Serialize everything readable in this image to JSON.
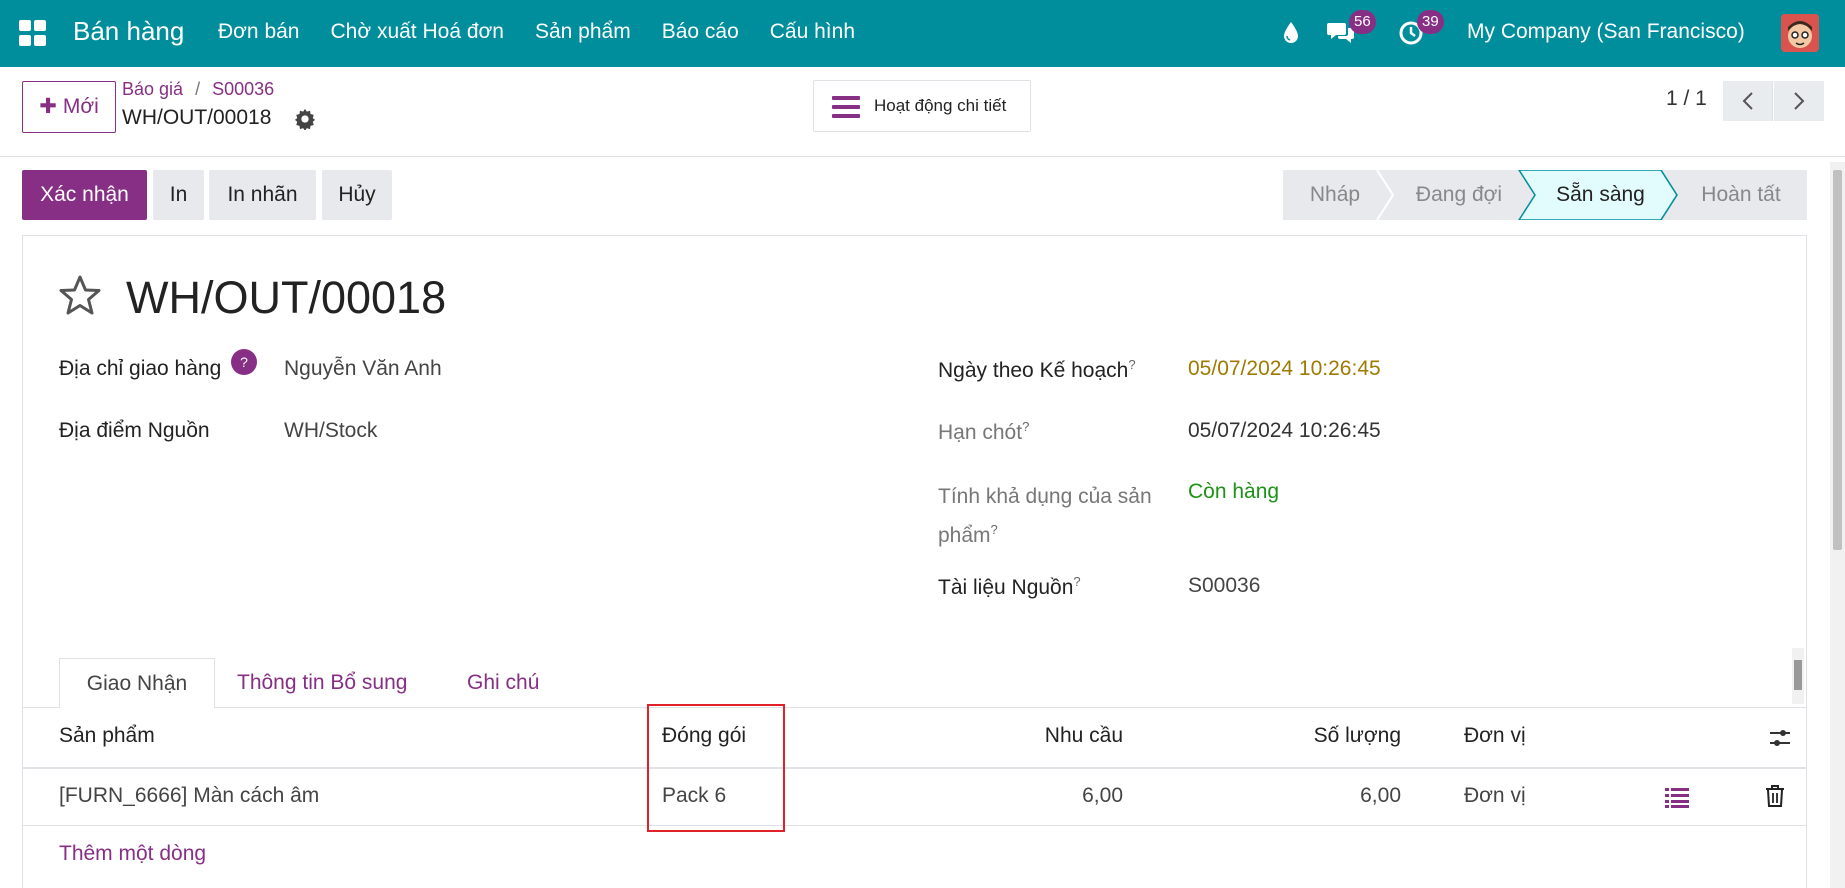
{
  "navbar": {
    "app_name": "Bán hàng",
    "menu": [
      "Đơn bán",
      "Chờ xuất Hoá đơn",
      "Sản phẩm",
      "Báo cáo",
      "Cấu hình"
    ],
    "messages_count": "56",
    "activities_count": "39",
    "company": "My Company (San Francisco)",
    "icons": [
      "apps-icon",
      "drop-icon",
      "chat-icon",
      "clock-icon"
    ]
  },
  "control_panel": {
    "new_label": "Mới",
    "breadcrumb": [
      "Báo giá",
      "S00036"
    ],
    "record_name": "WH/OUT/00018",
    "activity_label": "Hoạt động chi tiết",
    "pager": "1 / 1"
  },
  "statusbar": {
    "buttons": {
      "confirm": "Xác nhận",
      "print": "In",
      "print_label": "In nhãn",
      "cancel": "Hủy"
    },
    "stages": [
      "Nháp",
      "Đang đợi",
      "Sẵn sàng",
      "Hoàn tất"
    ],
    "active_stage": "Sẵn sàng",
    "active_color": "#e2fbfc",
    "active_border": "#018e9c"
  },
  "form": {
    "title": "WH/OUT/00018",
    "left": {
      "delivery_address_label": "Địa chỉ giao hàng",
      "delivery_address_help": "?",
      "delivery_address_value": "Nguyễn Văn Anh",
      "source_location_label": "Địa điểm Nguồn",
      "source_location_value": "WH/Stock"
    },
    "right": {
      "scheduled_label": "Ngày theo Kế hoạch",
      "scheduled_value": "05/07/2024 10:26:45",
      "deadline_label": "Hạn chót",
      "deadline_value": "05/07/2024 10:26:45",
      "availability_label_1": "Tính khả dụng của sản",
      "availability_label_2": "phẩm",
      "availability_value": "Còn hàng",
      "source_doc_label": "Tài liệu Nguồn",
      "source_doc_value": "S00036"
    },
    "help_mark": "?"
  },
  "tabs": [
    "Giao Nhận",
    "Thông tin Bổ sung",
    "Ghi chú"
  ],
  "table": {
    "headers": {
      "product": "Sản phẩm",
      "packaging": "Đóng gói",
      "demand": "Nhu cầu",
      "quantity": "Số lượng",
      "uom": "Đơn vị"
    },
    "rows": [
      {
        "product": "[FURN_6666] Màn cách âm",
        "packaging": "Pack 6",
        "demand": "6,00",
        "quantity": "6,00",
        "uom": "Đơn vị"
      }
    ],
    "add_line": "Thêm một dòng"
  },
  "colors": {
    "navbar": "#018e9c",
    "primary": "#872f85",
    "highlight": "#e0212a"
  }
}
